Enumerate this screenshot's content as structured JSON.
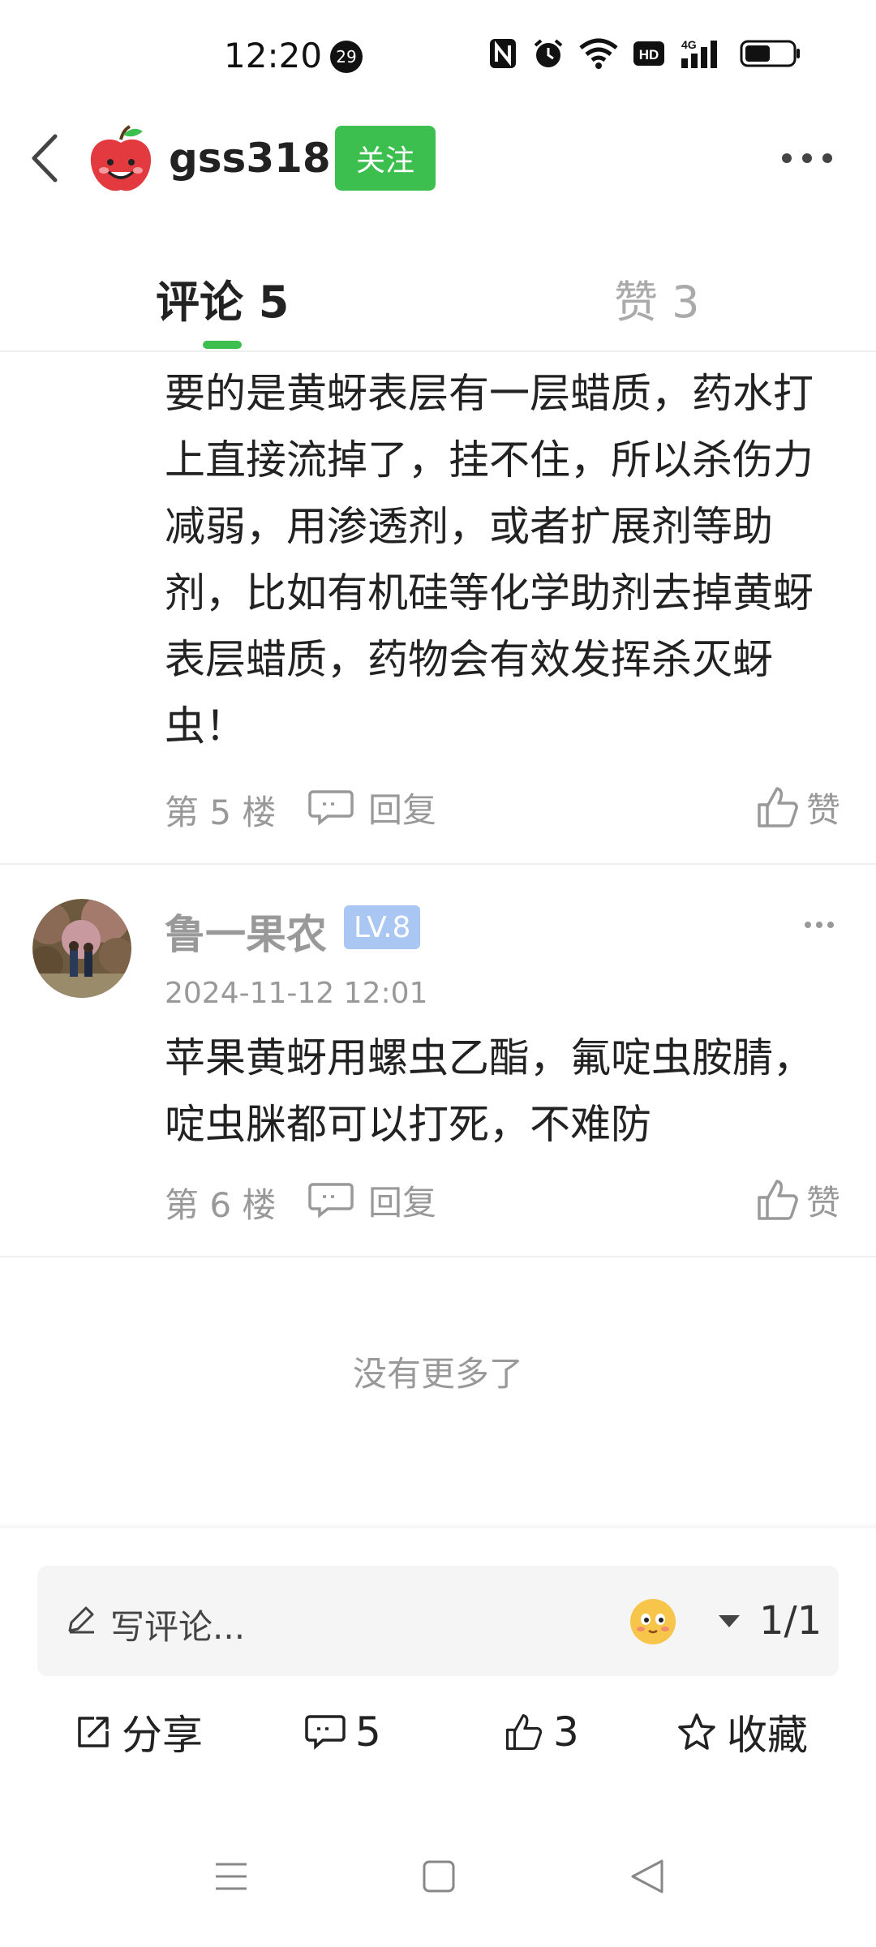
{
  "status_bar": {
    "time": "12:20",
    "notification_count": "29",
    "network": "4G",
    "hd": "HD"
  },
  "header": {
    "username": "gss318",
    "follow_label": "关注"
  },
  "tabs": {
    "comments": "评论 5",
    "likes": "赞 3"
  },
  "comments": [
    {
      "text": "要的是黄蚜表层有一层蜡质，药水打上直接流掉了，挂不住，所以杀伤力减弱，用渗透剂，或者扩展剂等助剂，比如有机硅等化学助剂去掉黄蚜表层蜡质，药物会有效发挥杀灭蚜虫！",
      "floor": "第 5 楼",
      "reply_label": "回复",
      "like_label": "赞"
    },
    {
      "author": "鲁一果农",
      "level": "LV.8",
      "date": "2024-11-12 12:01",
      "text": "苹果黄蚜用螺虫乙酯，氟啶虫胺腈，啶虫脒都可以打死，不难防",
      "floor": "第 6 楼",
      "reply_label": "回复",
      "like_label": "赞"
    }
  ],
  "no_more": "没有更多了",
  "bottom": {
    "input_placeholder": "写评论...",
    "page": "1/1",
    "share": "分享",
    "comment_count": "5",
    "like_count": "3",
    "favorite": "收藏"
  },
  "colors": {
    "accent": "#3dbf4f",
    "level_badge": "#a9c7f2",
    "muted_text": "#999999"
  }
}
